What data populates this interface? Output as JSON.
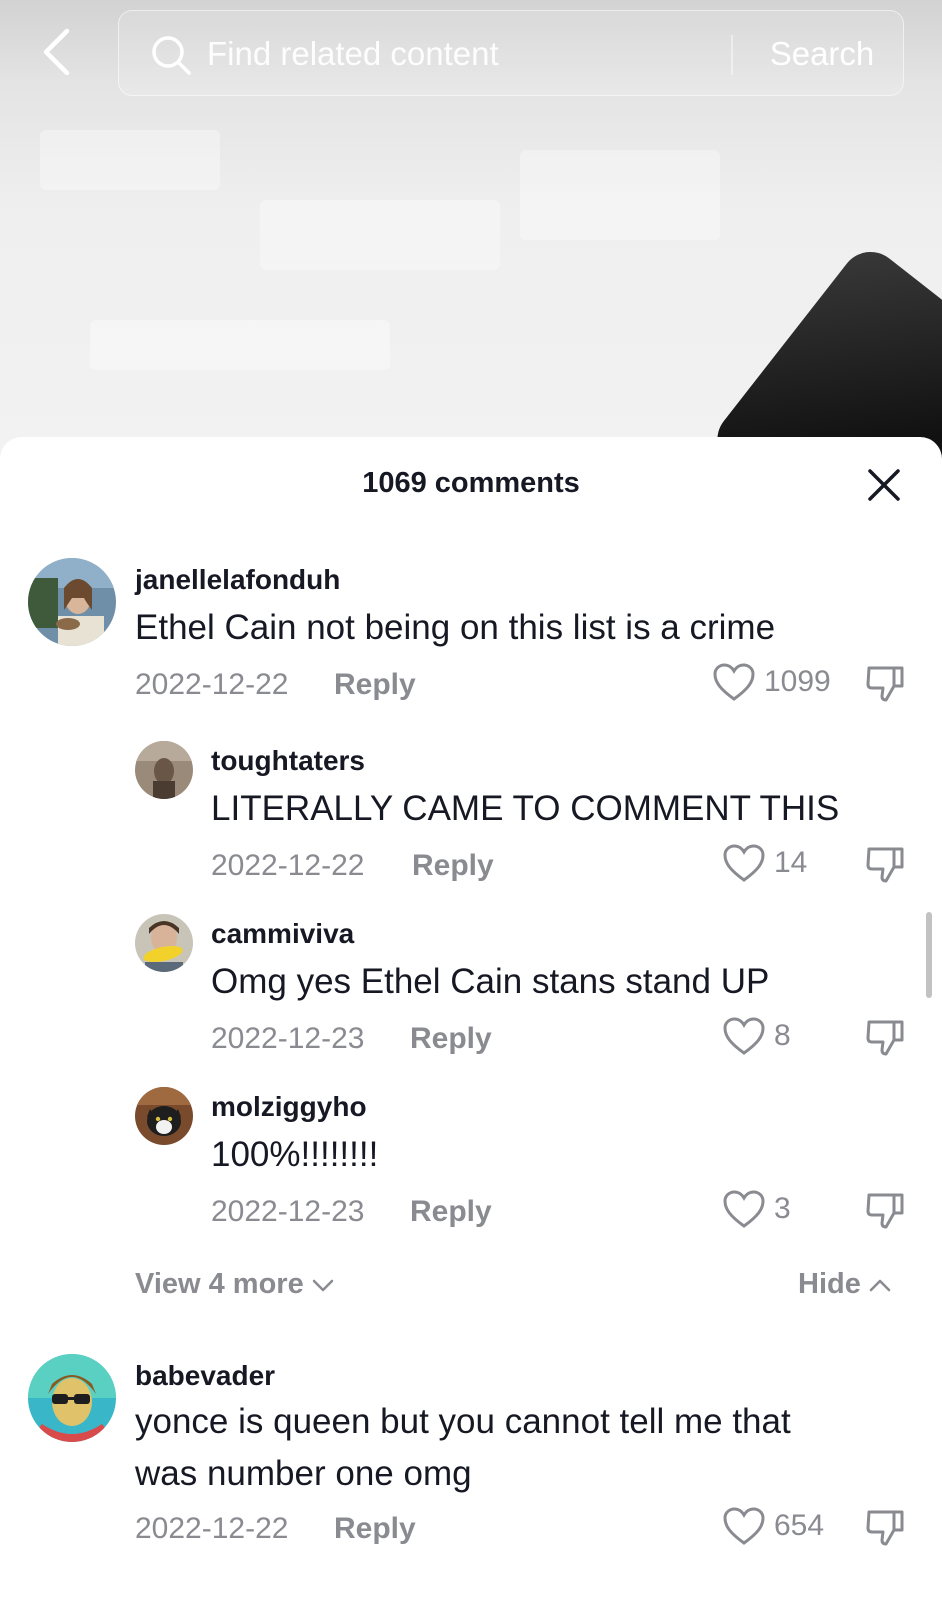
{
  "search": {
    "placeholder": "Find related content",
    "button_label": "Search"
  },
  "comments_panel": {
    "title": "1069 comments",
    "view_more_label": "View 4 more",
    "hide_label": "Hide"
  },
  "comments": [
    {
      "username": "janellelafonduh",
      "text": "Ethel Cain not being on this list is a crime",
      "date": "2022-12-22",
      "reply_label": "Reply",
      "likes": "1099",
      "replies": [
        {
          "username": "toughtaters",
          "text": "LITERALLY CAME TO COMMENT THIS",
          "date": "2022-12-22",
          "reply_label": "Reply",
          "likes": "14"
        },
        {
          "username": "cammiviva",
          "text": "Omg yes Ethel Cain stans stand UP",
          "date": "2022-12-23",
          "reply_label": "Reply",
          "likes": "8"
        },
        {
          "username": "molziggyho",
          "text": "100%!!!!!!!!",
          "date": "2022-12-23",
          "reply_label": "Reply",
          "likes": "3"
        }
      ]
    },
    {
      "username": "babevader",
      "text": "yonce is queen but you cannot tell me that was number one omg",
      "date": "2022-12-22",
      "reply_label": "Reply",
      "likes": "654"
    }
  ],
  "colors": {
    "primary_text": "#161823",
    "secondary_text": "#8a8b91",
    "sheet_background": "#ffffff"
  },
  "icons": {
    "back": "chevron-left-icon",
    "search": "search-icon",
    "close": "close-icon",
    "like": "heart-outline-icon",
    "dislike": "thumbs-down-icon",
    "view_more": "chevron-down-icon",
    "hide": "chevron-up-icon"
  }
}
